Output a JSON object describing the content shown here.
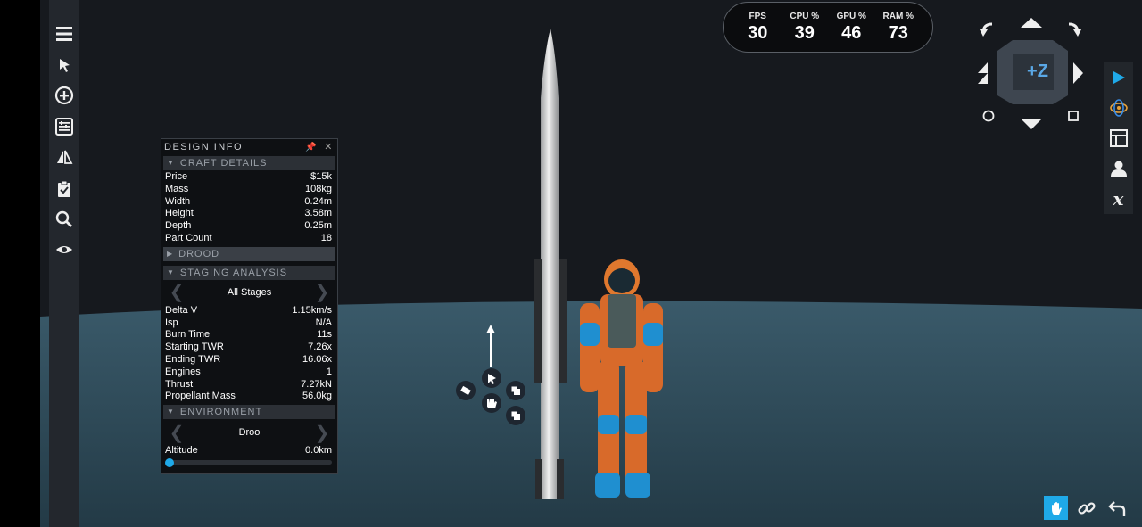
{
  "stats": [
    {
      "label": "FPS",
      "value": "30"
    },
    {
      "label": "CPU %",
      "value": "39"
    },
    {
      "label": "GPU %",
      "value": "46"
    },
    {
      "label": "RAM %",
      "value": "73"
    }
  ],
  "panel": {
    "title": "DESIGN INFO",
    "craft_details": {
      "header": "CRAFT DETAILS",
      "rows": [
        {
          "label": "Price",
          "value": "$15k"
        },
        {
          "label": "Mass",
          "value": "108kg"
        },
        {
          "label": "Width",
          "value": "0.24m"
        },
        {
          "label": "Height",
          "value": "3.58m"
        },
        {
          "label": "Depth",
          "value": "0.25m"
        },
        {
          "label": "Part Count",
          "value": "18"
        }
      ]
    },
    "drood_header": "DROOD",
    "staging": {
      "header": "STAGING ANALYSIS",
      "selector": "All Stages",
      "rows": [
        {
          "label": "Delta V",
          "value": "1.15km/s"
        },
        {
          "label": "Isp",
          "value": "N/A"
        },
        {
          "label": "Burn Time",
          "value": "11s"
        },
        {
          "label": "Starting TWR",
          "value": "7.26x"
        },
        {
          "label": "Ending TWR",
          "value": "16.06x"
        },
        {
          "label": "Engines",
          "value": "1"
        },
        {
          "label": "Thrust",
          "value": "7.27kN"
        },
        {
          "label": "Propellant Mass",
          "value": "56.0kg"
        }
      ]
    },
    "environment": {
      "header": "ENVIRONMENT",
      "selector": "Droo",
      "altitude_label": "Altitude",
      "altitude_value": "0.0km",
      "altitude_slider_fraction": 0.0
    }
  },
  "view_cube": {
    "label": "+Z"
  },
  "colors": {
    "accent": "#1fa9e8",
    "ground": "#2b4552",
    "sky": "#16191e"
  }
}
